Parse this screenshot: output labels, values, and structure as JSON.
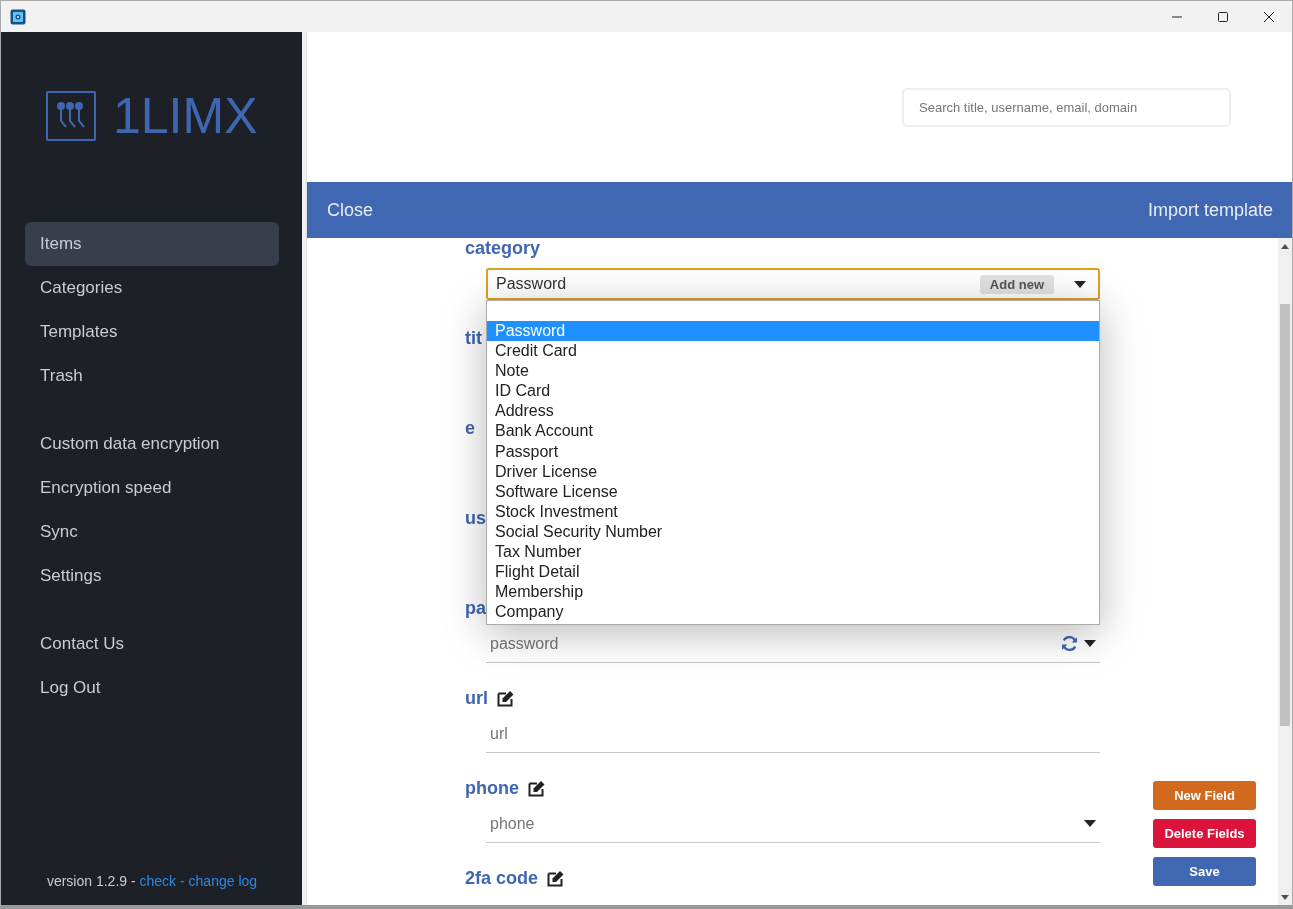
{
  "sidebar": {
    "logo": "1LIMX",
    "nav_groups": [
      [
        {
          "label": "Items",
          "selected": true
        },
        {
          "label": "Categories",
          "selected": false
        },
        {
          "label": "Templates",
          "selected": false
        },
        {
          "label": "Trash",
          "selected": false
        }
      ],
      [
        {
          "label": "Custom data encryption",
          "selected": false
        },
        {
          "label": "Encryption speed",
          "selected": false
        },
        {
          "label": "Sync",
          "selected": false
        },
        {
          "label": "Settings",
          "selected": false
        }
      ],
      [
        {
          "label": "Contact Us",
          "selected": false
        },
        {
          "label": "Log Out",
          "selected": false
        }
      ]
    ],
    "footer": {
      "text": "version 1.2.9 - ",
      "check_link": "check",
      "separator": " - ",
      "changelog_link": "change log"
    }
  },
  "search": {
    "placeholder": "Search title, username, email, domain"
  },
  "toolbar": {
    "close": "Close",
    "import": "Import template"
  },
  "form": {
    "fields": [
      {
        "label": "category",
        "kind": "select",
        "value": "Password",
        "add_button": "Add new",
        "focused": true,
        "editable": false
      },
      {
        "label": "tit",
        "kind": "covered",
        "editable": false
      },
      {
        "label": "e",
        "kind": "covered",
        "editable": false
      },
      {
        "label": "us",
        "kind": "covered",
        "editable": false
      },
      {
        "label": "pa",
        "kind": "password",
        "placeholder": "password",
        "editable": false
      },
      {
        "label": "url",
        "kind": "text",
        "placeholder": "url",
        "editable": true
      },
      {
        "label": "phone",
        "kind": "dropdown",
        "placeholder": "phone",
        "editable": true
      },
      {
        "label": "2fa code",
        "kind": "none",
        "editable": true
      }
    ],
    "dropdown_options": [
      {
        "label": "Password",
        "selected": true
      },
      {
        "label": "Credit Card",
        "selected": false
      },
      {
        "label": "Note",
        "selected": false
      },
      {
        "label": "ID Card",
        "selected": false
      },
      {
        "label": "Address",
        "selected": false
      },
      {
        "label": "Bank Account",
        "selected": false
      },
      {
        "label": "Passport",
        "selected": false
      },
      {
        "label": "Driver License",
        "selected": false
      },
      {
        "label": "Software License",
        "selected": false
      },
      {
        "label": "Stock Investment",
        "selected": false
      },
      {
        "label": "Social Security Number",
        "selected": false
      },
      {
        "label": "Tax Number",
        "selected": false
      },
      {
        "label": "Flight Detail",
        "selected": false
      },
      {
        "label": "Membership",
        "selected": false
      },
      {
        "label": "Company",
        "selected": false
      }
    ],
    "actions": [
      {
        "label": "New Field",
        "color": "#d2691e"
      },
      {
        "label": "Delete Fields",
        "color": "#dc143c"
      },
      {
        "label": "Save",
        "color": "#4067b1"
      }
    ]
  }
}
